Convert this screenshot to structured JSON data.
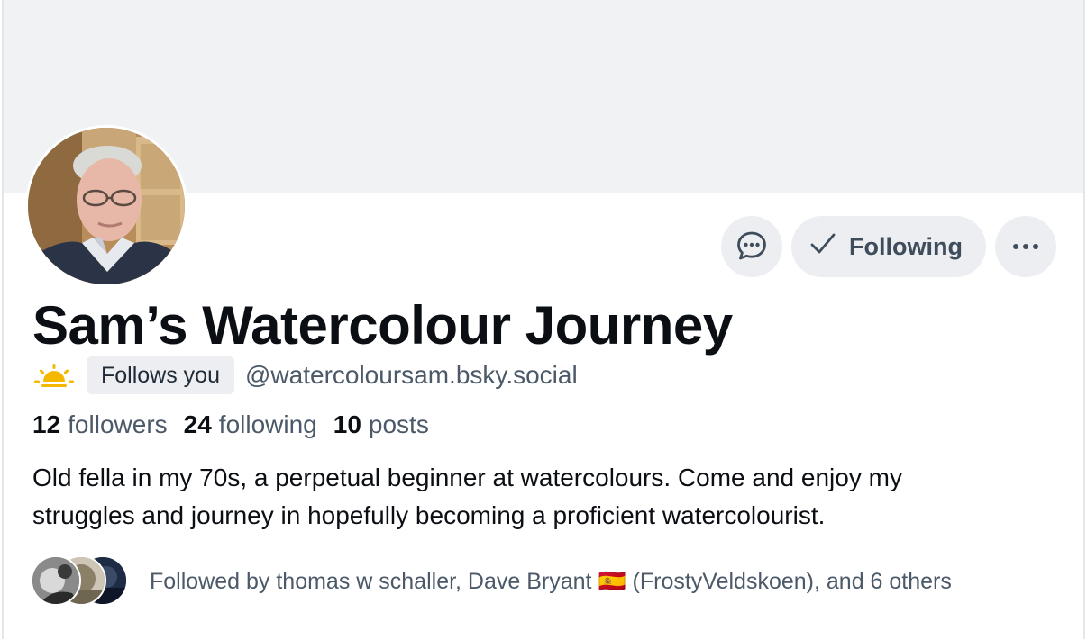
{
  "profile": {
    "display_name": "Sam’s Watercolour Journey",
    "follows_you_label": "Follows you",
    "handle": "@watercoloursam.bsky.social",
    "badge_icon": "sun-rising-icon",
    "badge_color": "#f5b800"
  },
  "actions": {
    "message_icon": "chat-bubble-icon",
    "following_label": "Following",
    "following_icon": "check-icon",
    "more_icon": "ellipsis-icon"
  },
  "stats": {
    "followers": {
      "count": "12",
      "label": "followers"
    },
    "following": {
      "count": "24",
      "label": "following"
    },
    "posts": {
      "count": "10",
      "label": "posts"
    }
  },
  "bio": {
    "line1": "Old fella in my 70s, a perpetual beginner at watercolours.  Come and enjoy my",
    "line2": "struggles and journey in hopefully becoming a proficient watercolourist."
  },
  "followed_by": {
    "text_prefix": "Followed by thomas w schaller, Dave Bryant ",
    "flag": "🇪🇸",
    "text_suffix": " (FrostyVeldskoen), and 6 others"
  },
  "colors": {
    "banner": "#f1f2f4",
    "button_bg": "#eceef1",
    "secondary_text": "#4b5968",
    "primary_text": "#0b0f14"
  }
}
